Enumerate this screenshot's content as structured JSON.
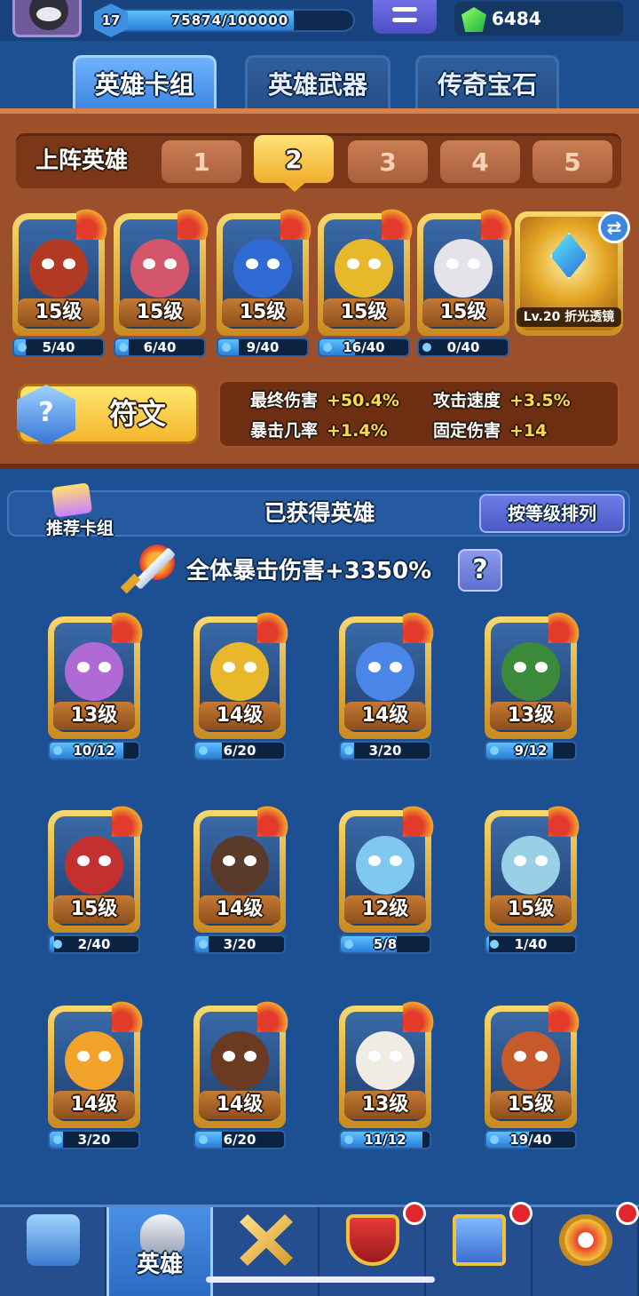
{
  "player": {
    "level": "17",
    "xp_text": "75874/100000",
    "xp_fraction": 0.75874,
    "gems": "6484"
  },
  "tabs": [
    {
      "label": "英雄卡组",
      "active": true
    },
    {
      "label": "英雄武器",
      "active": false
    },
    {
      "label": "传奇宝石",
      "active": false
    }
  ],
  "deck": {
    "slot_label": "上阵英雄",
    "slots": [
      "1",
      "2",
      "3",
      "4",
      "5"
    ],
    "active_slot": "2",
    "heroes": [
      {
        "level": "15级",
        "progress": "5/40",
        "fraction": 0.125,
        "color": "#b33a22"
      },
      {
        "level": "15级",
        "progress": "6/40",
        "fraction": 0.15,
        "color": "#d4566c"
      },
      {
        "level": "15级",
        "progress": "9/40",
        "fraction": 0.225,
        "color": "#2f6ad4"
      },
      {
        "level": "15级",
        "progress": "16/40",
        "fraction": 0.4,
        "color": "#e8b82c"
      },
      {
        "level": "15级",
        "progress": "0/40",
        "fraction": 0.0,
        "color": "#e6e2ea"
      }
    ],
    "lens": {
      "label": "Lv.20 折光透镜"
    },
    "rune_label": "符文",
    "stats": [
      {
        "key": "最终伤害",
        "value": "+50.4%"
      },
      {
        "key": "攻击速度",
        "value": "+3.5%"
      },
      {
        "key": "暴击几率",
        "value": "+1.4%"
      },
      {
        "key": "固定伤害",
        "value": "+14"
      }
    ]
  },
  "collection": {
    "recommend_label": "推荐卡组",
    "title": "已获得英雄",
    "sort_label": "按等级排列",
    "crit_text": "全体暴击伤害+3350%",
    "help_label": "?",
    "heroes": [
      {
        "level": "13级",
        "progress": "10/12",
        "fraction": 0.833,
        "color": "#b06ad6"
      },
      {
        "level": "14级",
        "progress": "6/20",
        "fraction": 0.3,
        "color": "#e8b82c"
      },
      {
        "level": "14级",
        "progress": "3/20",
        "fraction": 0.15,
        "color": "#4a86e8"
      },
      {
        "level": "13级",
        "progress": "9/12",
        "fraction": 0.75,
        "color": "#3a8a3a"
      },
      {
        "level": "15级",
        "progress": "2/40",
        "fraction": 0.05,
        "color": "#c23030"
      },
      {
        "level": "14级",
        "progress": "3/20",
        "fraction": 0.15,
        "color": "#5a3a2a"
      },
      {
        "level": "12级",
        "progress": "5/8",
        "fraction": 0.625,
        "color": "#7fc8f0"
      },
      {
        "level": "15级",
        "progress": "1/40",
        "fraction": 0.025,
        "color": "#9ad0e6"
      },
      {
        "level": "14级",
        "progress": "3/20",
        "fraction": 0.15,
        "color": "#f2a32c"
      },
      {
        "level": "14级",
        "progress": "6/20",
        "fraction": 0.3,
        "color": "#6a3a22"
      },
      {
        "level": "13级",
        "progress": "11/12",
        "fraction": 0.917,
        "color": "#f0ece4"
      },
      {
        "level": "15级",
        "progress": "19/40",
        "fraction": 0.475,
        "color": "#c65a2a"
      }
    ]
  },
  "nav": [
    {
      "name": "nav-chest",
      "icon": "treasure-chest-icon",
      "label": "",
      "dot": false
    },
    {
      "name": "nav-heroes",
      "icon": "knight-helmet-icon",
      "label": "英雄",
      "dot": false,
      "active": true
    },
    {
      "name": "nav-battle",
      "icon": "crossed-swords-icon",
      "label": "",
      "dot": false
    },
    {
      "name": "nav-guild",
      "icon": "crown-shield-icon",
      "label": "",
      "dot": true
    },
    {
      "name": "nav-social",
      "icon": "friends-icon",
      "label": "",
      "dot": true
    },
    {
      "name": "nav-explore",
      "icon": "compass-icon",
      "label": "",
      "dot": true
    }
  ]
}
